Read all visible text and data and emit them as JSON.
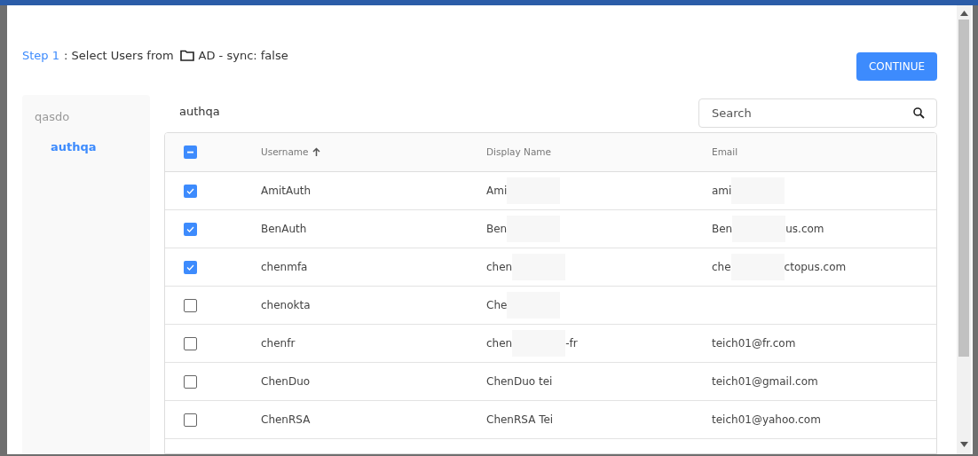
{
  "header": {
    "step": "Step 1",
    "title": ": Select Users from",
    "source": "AD - sync: false",
    "button": "CONTINUE"
  },
  "sidebar": {
    "items": [
      {
        "label": "qasdo",
        "selected": false,
        "children": [
          {
            "label": "authqa",
            "selected": true
          }
        ]
      }
    ]
  },
  "group_title": "authqa",
  "search": {
    "placeholder": "Search"
  },
  "table": {
    "select_all_checked": true,
    "select_all_indeterminate": true,
    "columns": [
      {
        "label": "Username",
        "sorted_ascending": true
      },
      {
        "label": "Display Name"
      },
      {
        "label": "Email"
      }
    ],
    "rows": [
      {
        "checked": true,
        "username": "AmitAuth",
        "display_name": {
          "text": "Ami",
          "redacted": true
        },
        "email": {
          "text": "ami",
          "redacted": true
        }
      },
      {
        "checked": true,
        "username": "BenAuth",
        "display_name": {
          "text": "Ben",
          "redacted": true
        },
        "email": {
          "text": "Ben",
          "redacted": true,
          "after": "us.com"
        }
      },
      {
        "checked": true,
        "username": "chenmfa",
        "display_name": {
          "text": "chen",
          "redacted": true
        },
        "email": {
          "text": "che",
          "redacted": true,
          "after": "ctopus.com"
        }
      },
      {
        "checked": false,
        "username": "chenokta",
        "display_name": {
          "text": "Che",
          "redacted": true
        }
      },
      {
        "checked": false,
        "username": "chenfr",
        "display_name": {
          "text": "chen",
          "redacted": true,
          "after": "-fr"
        },
        "email": {
          "text": "teich01@fr.com"
        }
      },
      {
        "checked": false,
        "username": "ChenDuo",
        "display_name": {
          "text": "ChenDuo tei"
        },
        "email": {
          "text": "teich01@gmail.com"
        }
      },
      {
        "checked": false,
        "username": "ChenRSA",
        "display_name": {
          "text": "ChenRSA Tei"
        },
        "email": {
          "text": "teich01@yahoo.com"
        }
      }
    ]
  }
}
